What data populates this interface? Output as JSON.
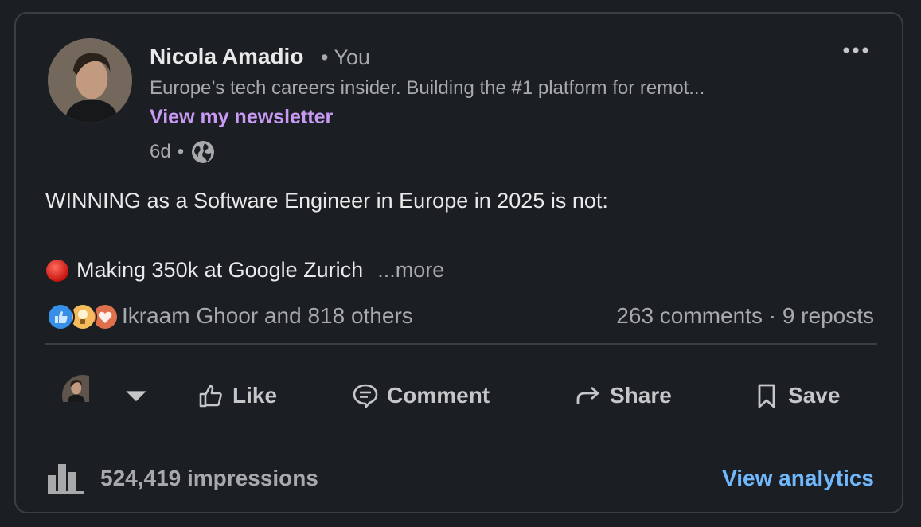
{
  "post": {
    "author": {
      "name": "Nicola Amadio",
      "relation": "• You",
      "headline": "Europe’s tech careers insider. Building the #1 platform for remot...",
      "newsletter_link": "View my newsletter",
      "age": "6d",
      "separator": "•",
      "visibility_icon": "globe-icon"
    },
    "menu_icon": "more-options-icon",
    "body": {
      "line1": "WINNING as a Software Engineer in Europe in 2025 is not:",
      "line2": "Making 350k at Google Zurich",
      "bullet_icon": "red-circle-icon",
      "see_more": "...more"
    },
    "social": {
      "reaction_icons": [
        "like-icon",
        "insightful-icon",
        "love-icon"
      ],
      "reactors": "Ikraam Ghoor and 818 others",
      "stats": "263 comments · 9 reposts"
    },
    "actions": {
      "like": "Like",
      "comment": "Comment",
      "share": "Share",
      "save": "Save"
    },
    "footer": {
      "impressions": "524,419 impressions",
      "analytics_link": "View analytics"
    }
  },
  "colors": {
    "background": "#1b1f23",
    "border": "#3a3f44",
    "primary_text": "#e9e9e9",
    "secondary_text": "#a7a9ab",
    "newsletter": "#c99af4",
    "link": "#71b7fb"
  }
}
